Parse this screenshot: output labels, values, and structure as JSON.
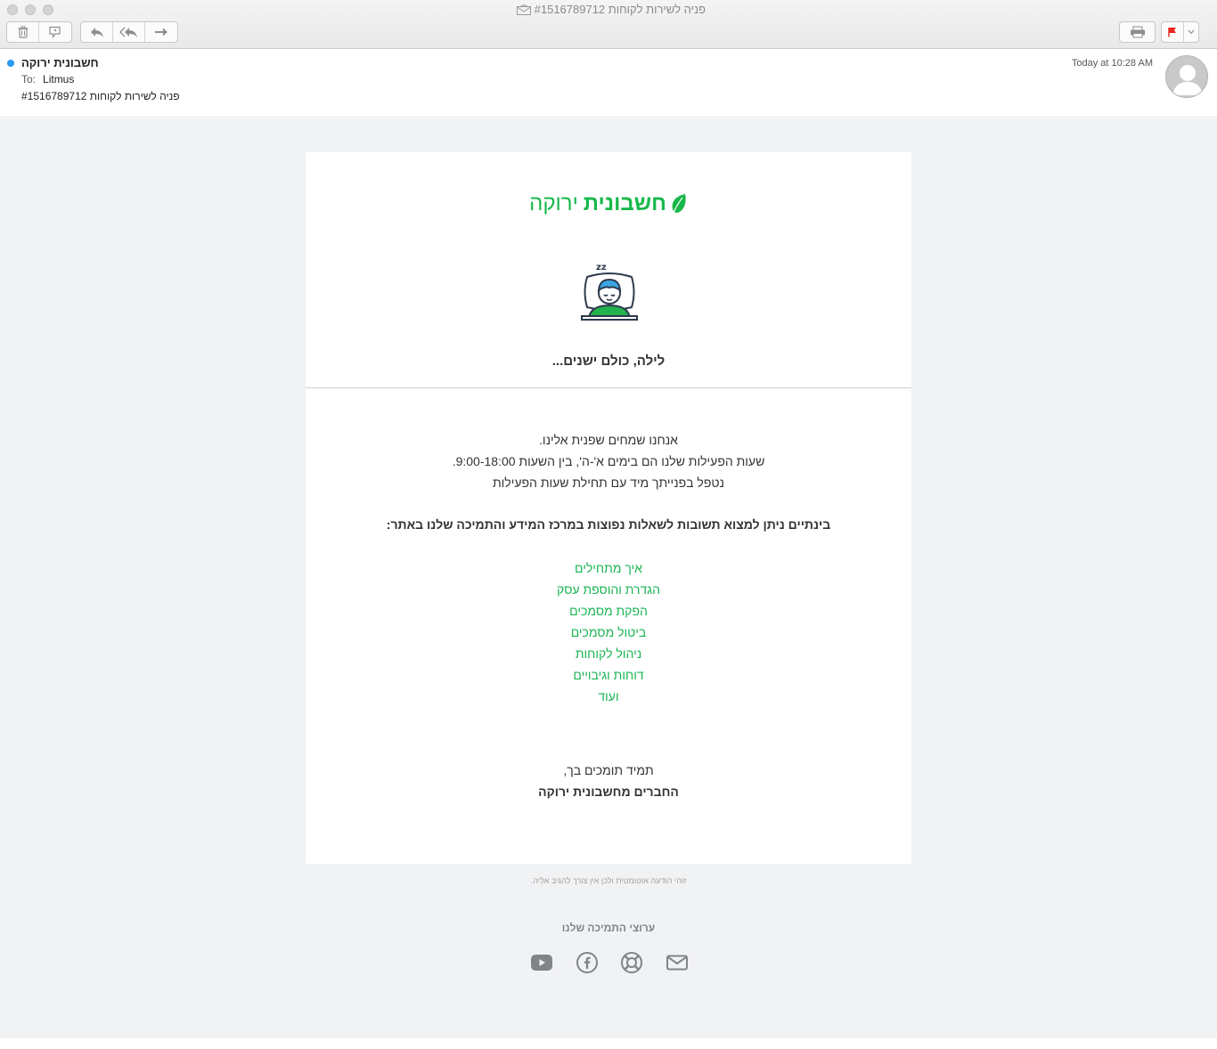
{
  "window": {
    "title": "פניה לשירות לקוחות #1516789712"
  },
  "toolbar": {
    "buttons": [
      "trash-icon",
      "junk-icon",
      "reply-icon",
      "reply-all-icon",
      "forward-icon",
      "print-icon",
      "flag-icon",
      "chevron-down-icon"
    ],
    "flag_color": "#e8261d"
  },
  "message": {
    "sender": "חשבונית ירוקה",
    "to_label": "To:",
    "to_value": "Litmus",
    "subject": "פניה לשירות לקוחות #1516789712",
    "datetime": "Today at 10:28 AM"
  },
  "email": {
    "brand_bold": "חשבונית",
    "brand_light": "ירוקה",
    "brand_color": "#17b84a",
    "night_title": "לילה, כולם ישנים...",
    "line1": "אנחנו שמחים שפנית אלינו.",
    "line2": "שעות הפעילות שלנו הם בימים א'-ה', בין השעות 9:00-18:00.",
    "line3": "נטפל בפנייתך מיד עם תחילת שעות הפעילות",
    "faq_intro": "בינתיים ניתן למצוא תשובות לשאלות נפוצות במרכז המידע והתמיכה שלנו באתר:",
    "links": [
      "איך מתחילים",
      "הגדרת והוספת עסק",
      "הפקת מסמכים",
      "ביטול מסמכים",
      "ניהול לקוחות",
      "דוחות וגיבויים",
      "ועוד"
    ],
    "signoff": "תמיד תומכים בך,",
    "signature": "החברים מחשבונית ירוקה",
    "auto_note": "זוהי הודעה אוטומטית ולכן אין צורך להגיב אליה.",
    "support_title": "ערוצי התמיכה שלנו",
    "support_icons": [
      "youtube-icon",
      "facebook-icon",
      "lifebuoy-icon",
      "mail-icon"
    ]
  }
}
